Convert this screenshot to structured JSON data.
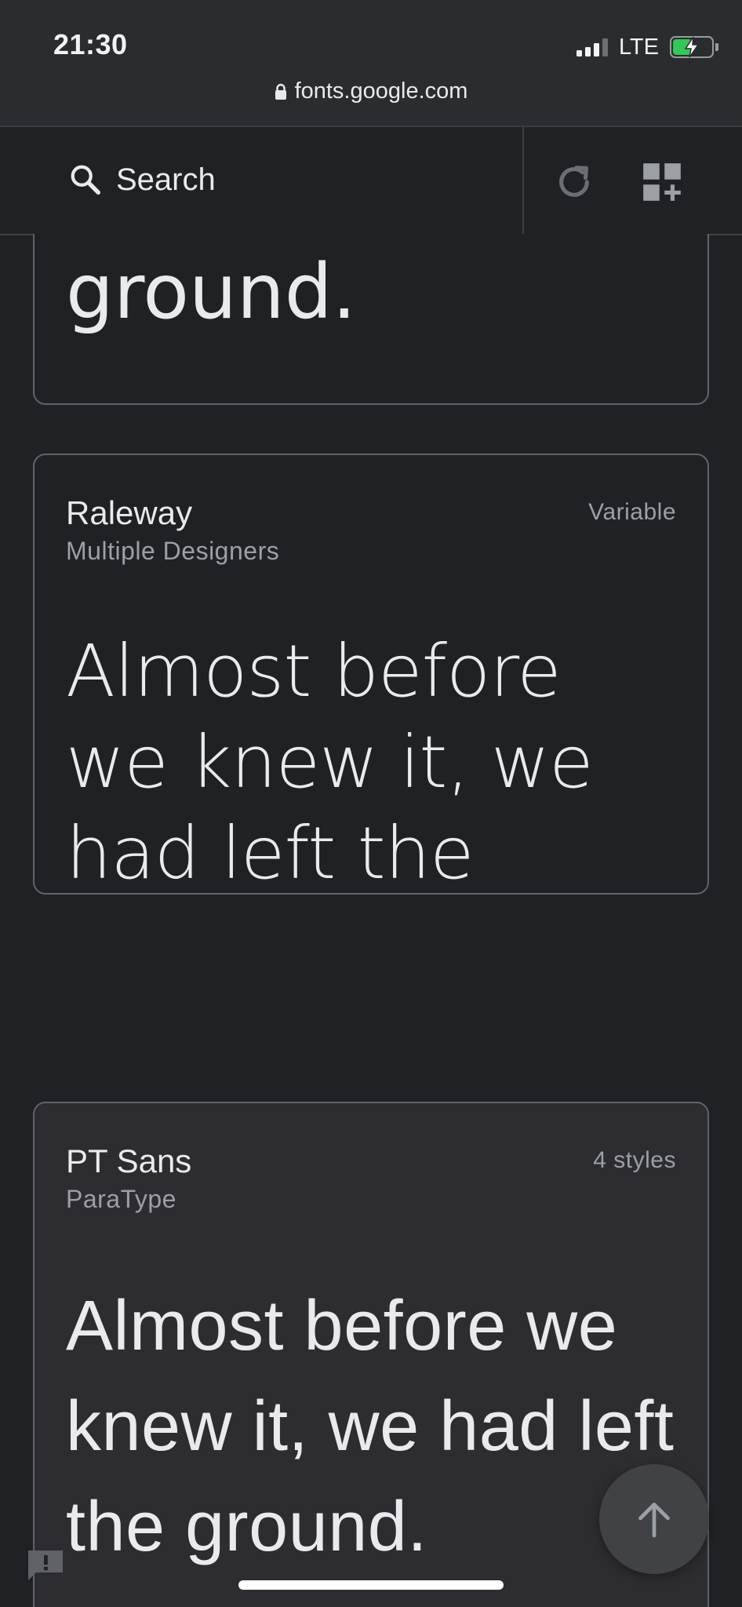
{
  "status_bar": {
    "time": "21:30",
    "network": "LTE",
    "signal_bars_active": 3,
    "signal_bars_total": 4,
    "battery_level": 0.5,
    "battery_charging": true
  },
  "browser": {
    "url": "fonts.google.com",
    "lock_icon": "lock-icon"
  },
  "toolbar": {
    "search_label": "Search",
    "search_icon": "search-icon",
    "refresh_icon": "refresh-icon",
    "add_grid_icon": "add-grid-icon"
  },
  "cards": [
    {
      "preview": "ground."
    },
    {
      "name": "Raleway",
      "designer": "Multiple Designers",
      "styles": "Variable",
      "preview": "Almost before we knew it, we had left the ground."
    },
    {
      "name": "PT Sans",
      "designer": "ParaType",
      "styles": "4 styles",
      "preview": "Almost before we knew it, we had left the ground."
    }
  ],
  "colors": {
    "background": "#202124",
    "chrome": "#2b2c30",
    "card_border": "#5f6368",
    "text_primary": "#e8eaed",
    "text_secondary": "#9aa0a6",
    "battery_green": "#34c759"
  },
  "overlays": {
    "scroll_top_icon": "arrow-up-icon",
    "feedback_icon": "feedback-icon"
  }
}
